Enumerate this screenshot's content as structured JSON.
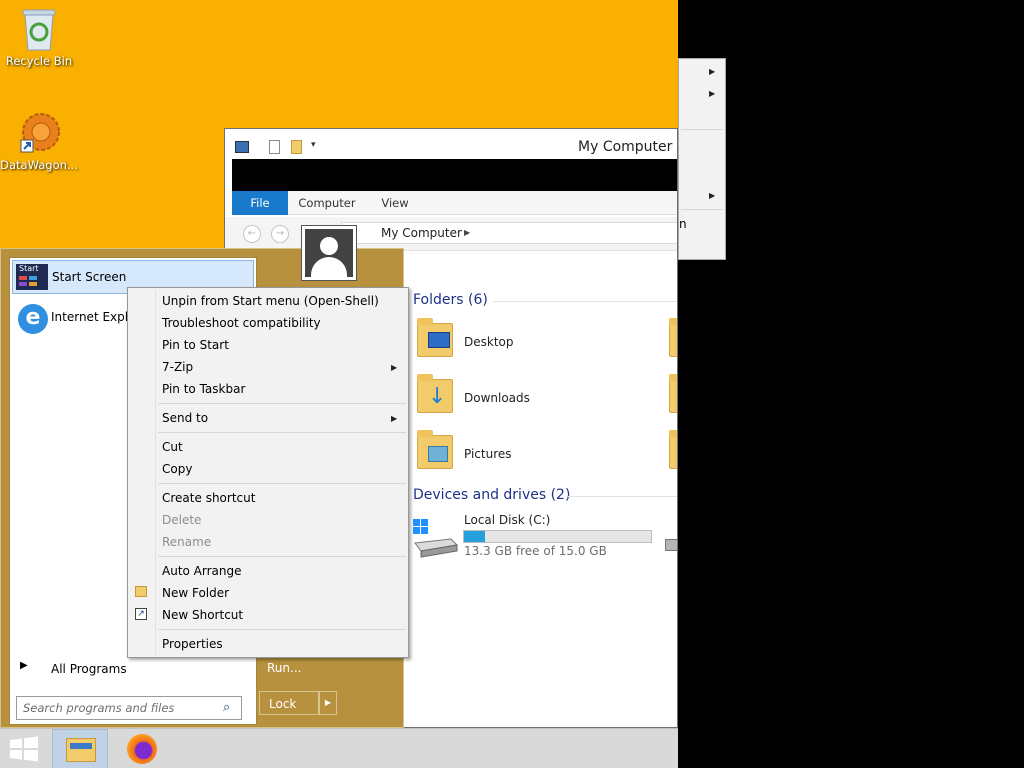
{
  "desktop": {
    "icons": [
      {
        "label": "Recycle Bin",
        "icon": "recycle-bin-icon"
      },
      {
        "label": "DataWagon...",
        "icon": "datawagon-shortcut-icon"
      }
    ]
  },
  "explorer": {
    "title": "My Computer",
    "ribbon_tabs": [
      "File",
      "Computer",
      "View"
    ],
    "address": "My Computer",
    "sections": {
      "folders": "Folders (6)",
      "devices": "Devices and drives (2)"
    },
    "folders": [
      "Desktop",
      "Downloads",
      "Pictures"
    ],
    "drive": {
      "name": "Local Disk (C:)",
      "free_text": "13.3 GB free of 15.0 GB",
      "used_fraction": 0.113
    }
  },
  "start_menu": {
    "start_screen": {
      "icon_text": "Start",
      "label": "Start Screen"
    },
    "pinned": [
      {
        "label": "Internet Explor",
        "icon": "internet-explorer-icon"
      }
    ],
    "all_programs": "All Programs",
    "run": "Run...",
    "lock": "Lock",
    "search_placeholder": "Search programs and files"
  },
  "context_menu": {
    "items": [
      {
        "label": "Unpin from Start menu (Open-Shell)"
      },
      {
        "label": "Troubleshoot compatibility"
      },
      {
        "label": "Pin to Start"
      },
      {
        "label": "7-Zip",
        "submenu": true
      },
      {
        "label": "Pin to Taskbar"
      },
      {
        "label": "Send to",
        "submenu": true
      },
      {
        "label": "Cut"
      },
      {
        "label": "Copy"
      },
      {
        "label": "Create shortcut"
      },
      {
        "label": "Delete",
        "disabled": true
      },
      {
        "label": "Rename",
        "disabled": true
      },
      {
        "label": "Auto Arrange"
      },
      {
        "label": "New Folder",
        "icon": "folder-icon"
      },
      {
        "label": "New Shortcut",
        "icon": "shortcut-icon"
      },
      {
        "label": "Properties"
      }
    ]
  },
  "background_menu": {
    "partial_text": "n"
  },
  "taskbar": {
    "buttons": [
      "start-button",
      "file-explorer-button",
      "firefox-button"
    ]
  },
  "colors": {
    "desktop": "#f9b000",
    "start_menu": "#b7913d",
    "accent": "#1979ca",
    "section_heading": "#1e3287"
  }
}
